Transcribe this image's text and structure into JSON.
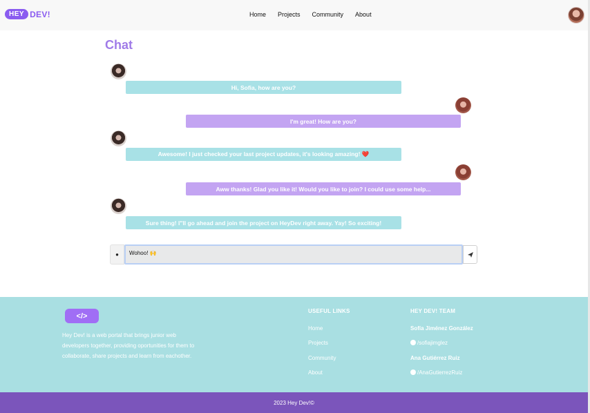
{
  "navbar": {
    "logo_part1": "HEY",
    "logo_part2": "DEV!",
    "links": [
      "Home",
      "Projects",
      "Community",
      "About"
    ]
  },
  "chat": {
    "title": "Chat",
    "messages": [
      {
        "side": "left",
        "text": "Hi, Sofia, how are you?"
      },
      {
        "side": "right",
        "text": "I'm great! How are you?"
      },
      {
        "side": "left",
        "text": "Awesome! I just checked your last project updates, it's looking amazing! ❤️"
      },
      {
        "side": "right",
        "text": "Aww thanks! Glad you like it! Would you like to join? I could use some help..."
      },
      {
        "side": "left",
        "text": "Sure thing! I\"ll go ahead and join the project on HeyDev right away. Yay! So exciting!"
      }
    ],
    "input_value": "Wohoo! 🙌"
  },
  "footer": {
    "logo_text": "</>",
    "description": "Hey Dev! is a web portal that brings junior web developers together, providing oportunities for them to collaborate, share projects and learn from eachother.",
    "useful_links_title": "USEFUL LINKS",
    "useful_links": [
      "Home",
      "Projects",
      "Community",
      "About"
    ],
    "team_title": "HEY DEV! TEAM",
    "team": [
      {
        "name": "Sofía Jiménez González",
        "github": "/sofiajimglez"
      },
      {
        "name": "Ana Gutiérrez Ruiz",
        "github": "/AnaGutierrezRuiz"
      }
    ],
    "copyright": "2023 Hey Dev!©"
  },
  "colors": {
    "accent": "#8a5cf0",
    "incoming_bubble": "#a8e1e6",
    "outgoing_bubble": "#c3a4f2",
    "footer_bg": "#a9dfe2",
    "copyright_bg": "#7b55bb"
  }
}
